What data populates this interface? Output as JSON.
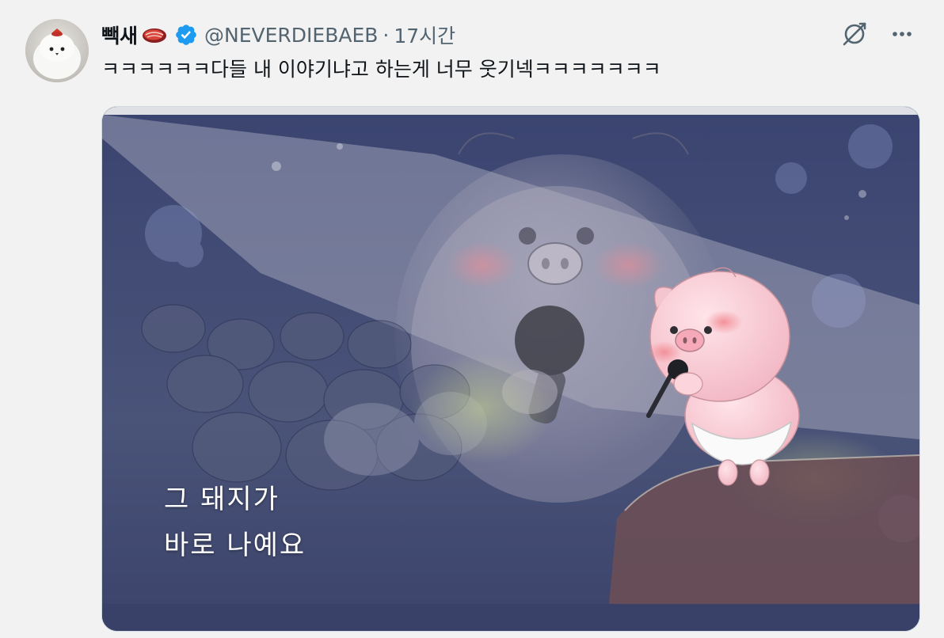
{
  "post": {
    "display_name": "빽새",
    "name_emoji": "meat-emoji",
    "verified_badge": "verified-badge-icon",
    "handle": "@NEVERDIEBAEB",
    "separator": "·",
    "timestamp": "17시간",
    "text": "ㅋㅋㅋㅋㅋㅋ다들 내 이야기냐고 하는게 너무 웃기넥ㅋㅋㅋㅋㅋㅋㅋ",
    "actions": {
      "grok_icon": "grok-icon",
      "more_icon": "more-icon"
    }
  },
  "media": {
    "subtitle_line1": "그 돼지가",
    "subtitle_line2": "바로 나예요"
  },
  "colors": {
    "verified_blue": "#1d9bf0",
    "text_primary": "#0f1419",
    "text_secondary": "#536471",
    "background": "#f2f2f2"
  }
}
